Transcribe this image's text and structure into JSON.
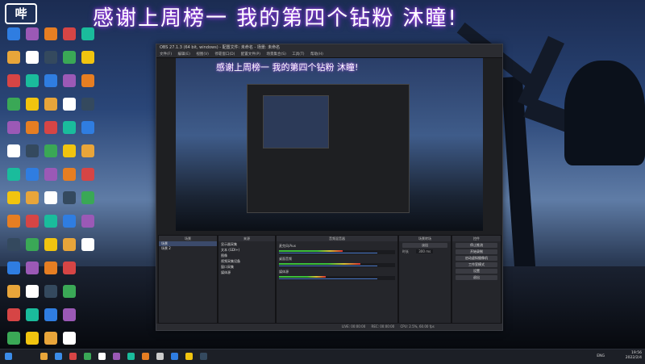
{
  "banner": "感谢上周榜一 我的第四个钻粉 沐瞳!",
  "logo_text": "哔",
  "obs": {
    "title": "OBS 27.1.3 (64 bit, windows) - 配置文件: 未命名 - 场景: 未命名",
    "menu": [
      "文件(F)",
      "编辑(E)",
      "视图(V)",
      "停靠窗口(D)",
      "配置文件(P)",
      "场景集合(S)",
      "工具(T)",
      "帮助(H)"
    ],
    "preview_banner": "感谢上周榜一 我的第四个钻粉 沐瞳!",
    "panels": {
      "scenes_title": "场景",
      "sources_title": "来源",
      "mixer_title": "音频混音器",
      "transitions_title": "场景转场",
      "controls_title": "控件"
    },
    "scenes": [
      "场景",
      "场景 2"
    ],
    "sources": [
      "显示器采集",
      "文本 (GDI+)",
      "图像",
      "视频采集设备",
      "窗口采集",
      "媒体源"
    ],
    "mixer": [
      {
        "name": "麦克风/Aux",
        "level": 0.55
      },
      {
        "name": "桌面音频",
        "level": 0.7
      },
      {
        "name": "媒体源",
        "level": 0.4
      }
    ],
    "transition": {
      "type": "淡出",
      "duration_label": "时长",
      "duration": "300 ms"
    },
    "controls": [
      "停止推流",
      "开始录制",
      "启动虚拟摄像机",
      "工作室模式",
      "设置",
      "退出"
    ],
    "status": {
      "live": "LIVE: 00:00:00",
      "rec": "REC: 00:00:00",
      "cpu": "CPU: 2.5%, 60.00 fps",
      "kb": "kb/s: 0"
    }
  },
  "taskbar": {
    "lang": "ENG",
    "time": "19:56",
    "date": "2022/2/4"
  },
  "colors": {
    "accent": "#c04bff",
    "obs_bg": "#1e1f22",
    "meter_green": "#3cbf3c"
  }
}
